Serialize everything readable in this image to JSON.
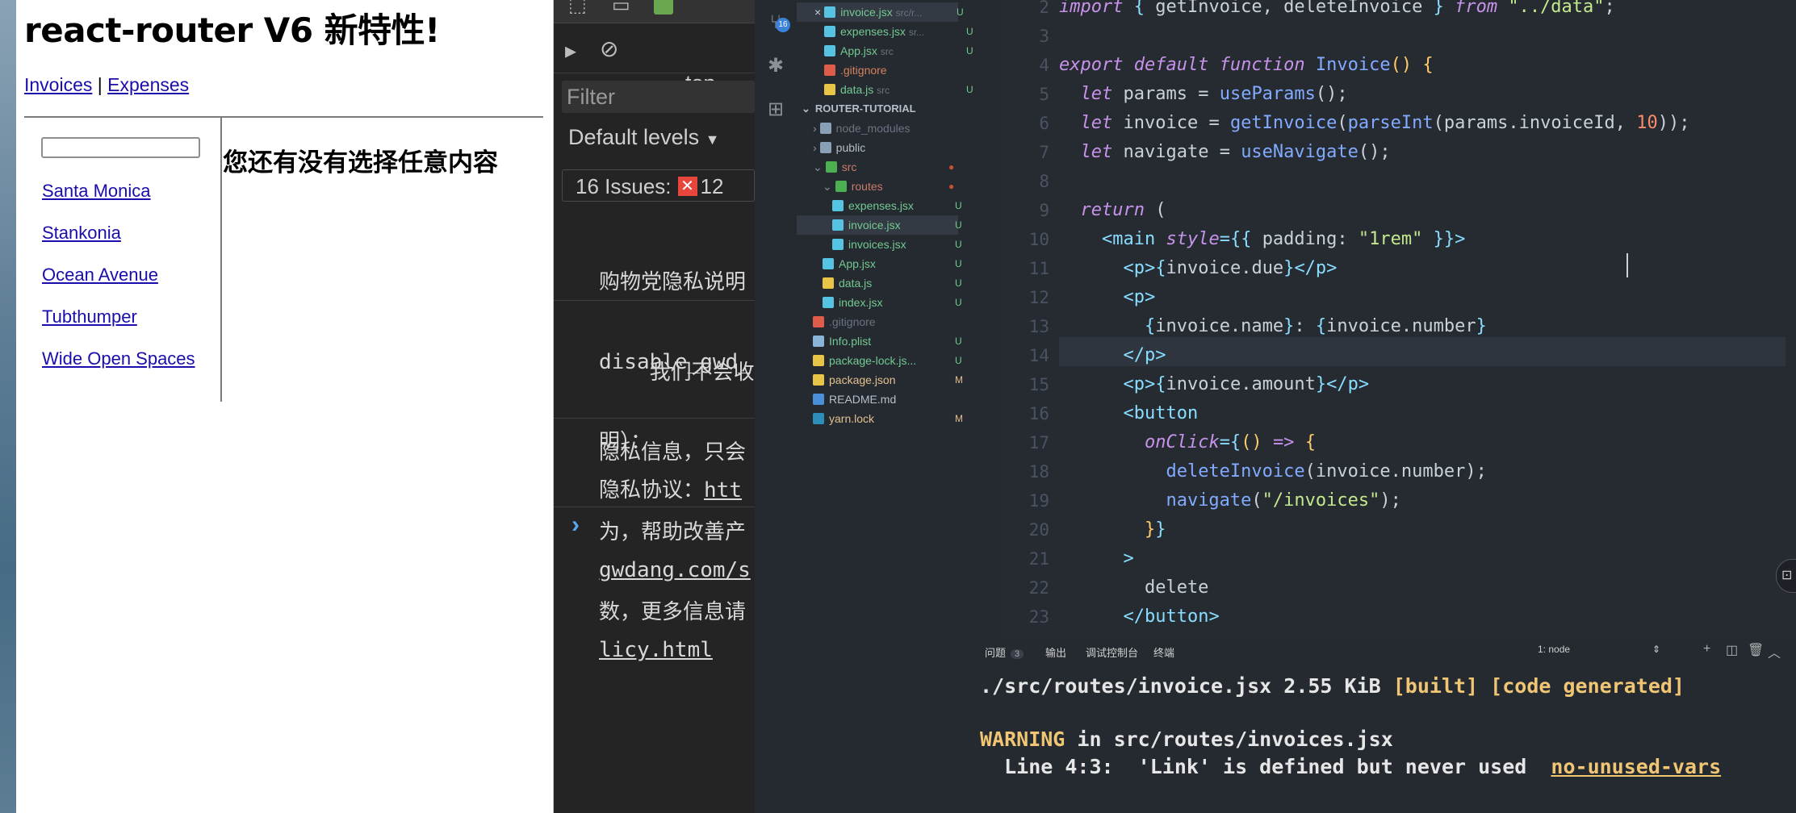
{
  "app": {
    "title": "react-router V6 新特性!",
    "nav": {
      "invoices": "Invoices",
      "separator": "|",
      "expenses": "Expenses"
    },
    "search_value": "",
    "invoices": [
      "Santa Monica",
      "Stankonia",
      "Ocean Avenue",
      "Tubthumper",
      "Wide Open Spaces"
    ],
    "empty_message": "您还有没有选择任意内容"
  },
  "devtools": {
    "context": "top",
    "filter_placeholder": "Filter",
    "levels": "Default levels",
    "issues_label": "16 Issues:",
    "issues_error_count": "12",
    "message1": [
      "购物党隐私说明",
      "disable_gwd_",
      "明）："
    ],
    "message2": [
      "    我们不会收",
      "隐私信息，只会",
      "为，帮助改善产",
      "数，更多信息请"
    ],
    "message3_label": "隐私协议：",
    "message3_link": [
      "htt",
      "gwdang.com/s",
      "licy.html"
    ],
    "prompt": "›"
  },
  "activity": {
    "badge": "16"
  },
  "explorer": {
    "open_editors": [
      {
        "name": "invoice.jsx",
        "path": "src/r...",
        "status": "U",
        "color": "#57c3e3"
      },
      {
        "name": "expenses.jsx",
        "path": "sr...",
        "status": "U",
        "color": "#57c3e3"
      },
      {
        "name": "App.jsx",
        "path": "src",
        "status": "U",
        "color": "#57c3e3"
      },
      {
        "name": ".gitignore",
        "path": "",
        "status": "",
        "color": "#e05c4a"
      },
      {
        "name": "data.js",
        "path": "src",
        "status": "U",
        "color": "#e8c547"
      }
    ],
    "project": "ROUTER-TUTORIAL",
    "tree": [
      {
        "name": "node_modules",
        "indent": 1,
        "kind": "folder",
        "status": ""
      },
      {
        "name": "public",
        "indent": 1,
        "kind": "folder",
        "status": ""
      },
      {
        "name": "src",
        "indent": 1,
        "kind": "folder-open",
        "status": "dot"
      },
      {
        "name": "routes",
        "indent": 2,
        "kind": "folder-open",
        "status": "dot"
      },
      {
        "name": "expenses.jsx",
        "indent": 3,
        "kind": "react",
        "status": "U"
      },
      {
        "name": "invoice.jsx",
        "indent": 3,
        "kind": "react",
        "status": "U"
      },
      {
        "name": "invoices.jsx",
        "indent": 3,
        "kind": "react",
        "status": "U"
      },
      {
        "name": "App.jsx",
        "indent": 2,
        "kind": "react",
        "status": "U"
      },
      {
        "name": "data.js",
        "indent": 2,
        "kind": "js",
        "status": "U"
      },
      {
        "name": "index.jsx",
        "indent": 2,
        "kind": "react",
        "status": "U"
      },
      {
        "name": ".gitignore",
        "indent": 1,
        "kind": "git",
        "status": ""
      },
      {
        "name": "Info.plist",
        "indent": 1,
        "kind": "plist",
        "status": "U"
      },
      {
        "name": "package-lock.js...",
        "indent": 1,
        "kind": "json",
        "status": "U"
      },
      {
        "name": "package.json",
        "indent": 1,
        "kind": "json",
        "status": "M"
      },
      {
        "name": "README.md",
        "indent": 1,
        "kind": "md",
        "status": ""
      },
      {
        "name": "yarn.lock",
        "indent": 1,
        "kind": "yarn",
        "status": "M"
      }
    ]
  },
  "editor": {
    "line_numbers": [
      "2",
      "3",
      "4",
      "5",
      "6",
      "7",
      "8",
      "9",
      "10",
      "11",
      "12",
      "13",
      "14",
      "15",
      "16",
      "17",
      "18",
      "19",
      "20",
      "21",
      "22",
      "23"
    ],
    "lines": [
      [
        [
          "kw",
          "import "
        ],
        [
          "punc",
          "{ "
        ],
        [
          "t",
          "getInvoice, deleteInvoice "
        ],
        [
          "punc",
          "} "
        ],
        [
          "kw",
          "from "
        ],
        [
          "str",
          "\"../data\""
        ],
        [
          "t",
          ";"
        ]
      ],
      [],
      [
        [
          "kw",
          "export default "
        ],
        [
          "kw",
          "function "
        ],
        [
          "fn",
          "Invoice"
        ],
        [
          "brace",
          "() {"
        ]
      ],
      [
        [
          "t",
          "  "
        ],
        [
          "kw",
          "let "
        ],
        [
          "t",
          "params = "
        ],
        [
          "fn",
          "useParams"
        ],
        [
          "t",
          "();"
        ]
      ],
      [
        [
          "t",
          "  "
        ],
        [
          "kw",
          "let "
        ],
        [
          "t",
          "invoice = "
        ],
        [
          "fn",
          "getInvoice"
        ],
        [
          "t",
          "("
        ],
        [
          "fn",
          "parseInt"
        ],
        [
          "t",
          "(params."
        ],
        [
          "t",
          "invoiceId, "
        ],
        [
          "num",
          "10"
        ],
        [
          "t",
          "));"
        ]
      ],
      [
        [
          "t",
          "  "
        ],
        [
          "kw",
          "let "
        ],
        [
          "t",
          "navigate = "
        ],
        [
          "fn",
          "useNavigate"
        ],
        [
          "t",
          "();"
        ]
      ],
      [],
      [
        [
          "t",
          "  "
        ],
        [
          "kw",
          "return "
        ],
        [
          "t",
          "("
        ]
      ],
      [
        [
          "t",
          "    "
        ],
        [
          "tag",
          "<main "
        ],
        [
          "prop",
          "style"
        ],
        [
          "punc",
          "={{ "
        ],
        [
          "t",
          "padding: "
        ],
        [
          "str",
          "\"1rem\""
        ],
        [
          "punc",
          " }}"
        ],
        [
          "tag",
          ">"
        ]
      ],
      [
        [
          "t",
          "      "
        ],
        [
          "tag",
          "<p>"
        ],
        [
          "punc",
          "{"
        ],
        [
          "t",
          "invoice.due"
        ],
        [
          "punc",
          "}"
        ],
        [
          "tag",
          "</p>"
        ]
      ],
      [
        [
          "t",
          "      "
        ],
        [
          "tag",
          "<p>"
        ]
      ],
      [
        [
          "t",
          "        "
        ],
        [
          "punc",
          "{"
        ],
        [
          "t",
          "invoice.name"
        ],
        [
          "punc",
          "}"
        ],
        [
          "t",
          ": "
        ],
        [
          "punc",
          "{"
        ],
        [
          "t",
          "invoice.number"
        ],
        [
          "punc",
          "}"
        ]
      ],
      [
        [
          "t",
          "      "
        ],
        [
          "tag",
          "</p>"
        ]
      ],
      [
        [
          "t",
          "      "
        ],
        [
          "tag",
          "<p>"
        ],
        [
          "punc",
          "{"
        ],
        [
          "t",
          "invoice.amount"
        ],
        [
          "punc",
          "}"
        ],
        [
          "tag",
          "</p>"
        ]
      ],
      [
        [
          "t",
          "      "
        ],
        [
          "tag",
          "<button"
        ]
      ],
      [
        [
          "t",
          "        "
        ],
        [
          "prop",
          "onClick"
        ],
        [
          "punc",
          "={"
        ],
        [
          "brace",
          "() "
        ],
        [
          "kw",
          "=> "
        ],
        [
          "brace",
          "{"
        ]
      ],
      [
        [
          "t",
          "          "
        ],
        [
          "fn",
          "deleteInvoice"
        ],
        [
          "t",
          "(invoice.number);"
        ]
      ],
      [
        [
          "t",
          "          "
        ],
        [
          "fn",
          "navigate"
        ],
        [
          "t",
          "("
        ],
        [
          "str",
          "\"/invoices\""
        ],
        [
          "t",
          ");"
        ]
      ],
      [
        [
          "t",
          "        "
        ],
        [
          "brace",
          "}"
        ],
        [
          "punc",
          "}"
        ]
      ],
      [
        [
          "t",
          "      "
        ],
        [
          "tag",
          ">"
        ]
      ],
      [
        [
          "t",
          "        delete"
        ]
      ],
      [
        [
          "t",
          "      "
        ],
        [
          "tag",
          "</button>"
        ]
      ]
    ]
  },
  "panel": {
    "tabs": [
      "问题",
      "输出",
      "调试控制台",
      "终端"
    ],
    "problems_badge": "3",
    "terminal_select": "1: node",
    "terminal": {
      "line1_path": "./src/routes/invoice.jsx 2.55 KiB ",
      "line1_tags": "[built] [code generated]",
      "line2_warning": "WARNING",
      "line2_rest": " in src/routes/invoices.jsx",
      "line3_text": "  Line 4:3:  'Link' is defined but never used  ",
      "line3_rule": "no-unused-vars"
    }
  },
  "colors": {
    "link": "#1a0dab",
    "keyword": "#c792ea",
    "function": "#82aaff",
    "string": "#c3e88d",
    "number": "#f78c6c",
    "warning": "#f0c674"
  }
}
